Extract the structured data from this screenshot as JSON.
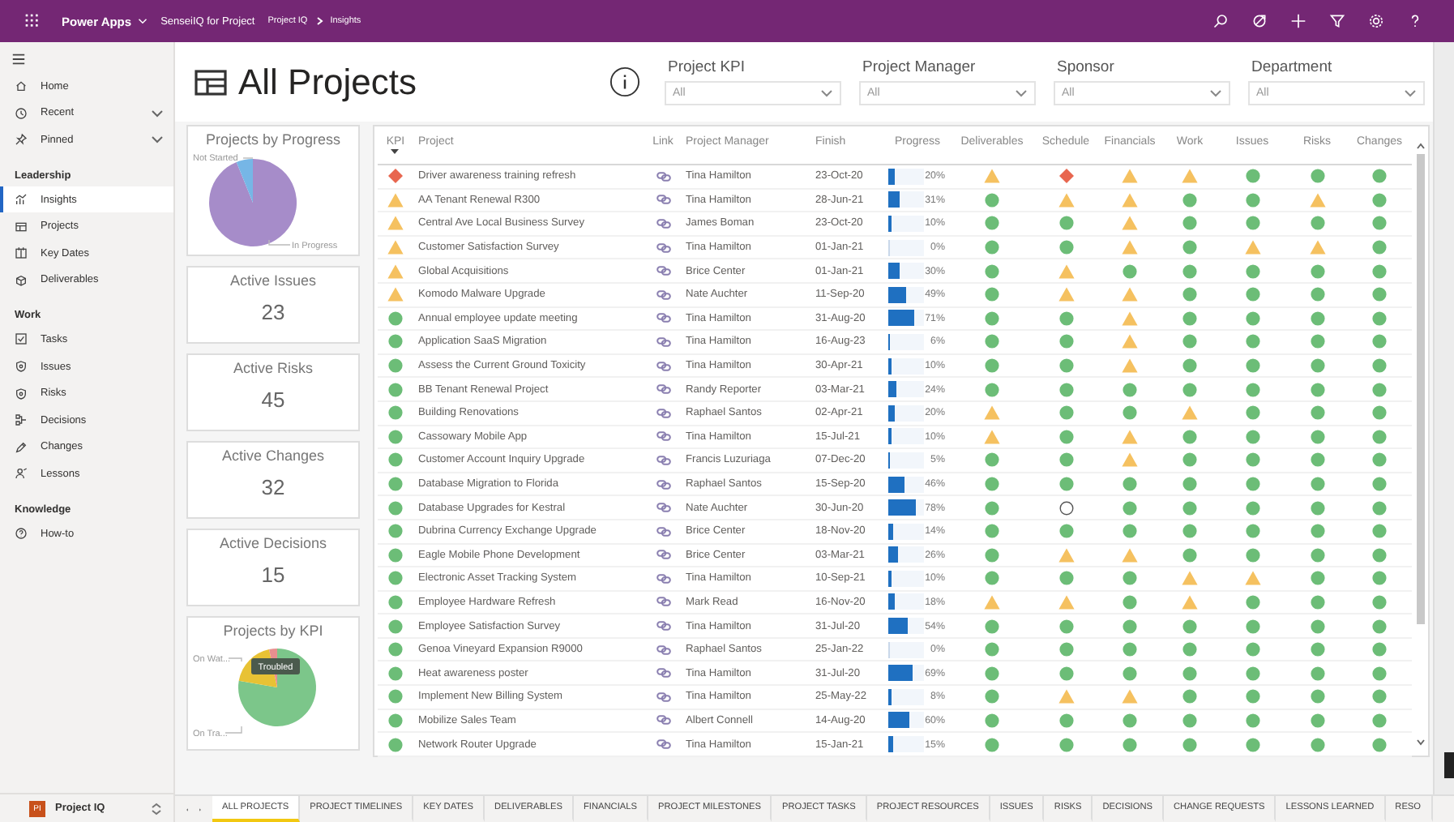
{
  "top_bar": {
    "app_name": "Power Apps",
    "environment": "SenseiIQ for Project",
    "breadcrumb": [
      "Project IQ",
      "Insights"
    ]
  },
  "sidebar": {
    "top_items": [
      {
        "label": "Home",
        "has_menu": false,
        "selected": false
      },
      {
        "label": "Recent",
        "has_menu": true,
        "selected": false
      },
      {
        "label": "Pinned",
        "has_menu": true,
        "selected": false
      }
    ],
    "sections": [
      {
        "title": "Leadership",
        "items": [
          {
            "label": "Insights",
            "selected": true
          },
          {
            "label": "Projects",
            "selected": false
          },
          {
            "label": "Key Dates",
            "selected": false
          },
          {
            "label": "Deliverables",
            "selected": false
          }
        ]
      },
      {
        "title": "Work",
        "items": [
          {
            "label": "Tasks",
            "selected": false
          },
          {
            "label": "Issues",
            "selected": false
          },
          {
            "label": "Risks",
            "selected": false
          },
          {
            "label": "Decisions",
            "selected": false
          },
          {
            "label": "Changes",
            "selected": false
          },
          {
            "label": "Lessons",
            "selected": false
          }
        ]
      },
      {
        "title": "Knowledge",
        "items": [
          {
            "label": "How-to",
            "selected": false
          }
        ]
      }
    ],
    "app_switcher": {
      "badge": "PI",
      "name": "Project IQ"
    }
  },
  "page": {
    "title": "All Projects"
  },
  "filters": [
    {
      "label": "Project KPI",
      "value": "All"
    },
    {
      "label": "Project Manager",
      "value": "All"
    },
    {
      "label": "Sponsor",
      "value": "All"
    },
    {
      "label": "Department",
      "value": "All"
    }
  ],
  "cards": [
    {
      "kind": "progress_pie",
      "title": "Projects by Progress",
      "labels": [
        "Not Started",
        "In Progress"
      ]
    },
    {
      "kind": "metric",
      "title": "Active Issues",
      "value": "23"
    },
    {
      "kind": "metric",
      "title": "Active Risks",
      "value": "45"
    },
    {
      "kind": "metric",
      "title": "Active Changes",
      "value": "32"
    },
    {
      "kind": "metric",
      "title": "Active Decisions",
      "value": "15"
    },
    {
      "kind": "kpi_pie",
      "title": "Projects by KPI",
      "labels": [
        "On Wat...",
        "On Tra..."
      ],
      "tooltip": "Troubled"
    }
  ],
  "table": {
    "columns": [
      {
        "label": "KPI",
        "sorted": true
      },
      {
        "label": "Project",
        "sorted": false
      },
      {
        "label": "Link",
        "sorted": false
      },
      {
        "label": "Project Manager",
        "sorted": false
      },
      {
        "label": "Finish",
        "sorted": false
      },
      {
        "label": "Progress",
        "sorted": false
      },
      {
        "label": "Deliverables",
        "sorted": false
      },
      {
        "label": "Schedule",
        "sorted": false
      },
      {
        "label": "Financials",
        "sorted": false
      },
      {
        "label": "Work",
        "sorted": false
      },
      {
        "label": "Issues",
        "sorted": false
      },
      {
        "label": "Risks",
        "sorted": false
      },
      {
        "label": "Changes",
        "sorted": false
      }
    ],
    "rows": [
      {
        "kpi": {
          "kind": "critical"
        },
        "project": "Driver awareness training refresh",
        "manager": "Tina Hamilton",
        "finish": "23-Oct-20",
        "progress": "20%",
        "level": 0.2,
        "statuses": [
          {
            "kind": "warning"
          },
          {
            "kind": "critical"
          },
          {
            "kind": "warning"
          },
          {
            "kind": "warning"
          },
          {
            "kind": "good"
          },
          {
            "kind": "good"
          },
          {
            "kind": "good"
          }
        ]
      },
      {
        "kpi": {
          "kind": "warning"
        },
        "project": "AA Tenant Renewal R300",
        "manager": "Tina Hamilton",
        "finish": "28-Jun-21",
        "progress": "31%",
        "level": 0.31,
        "statuses": [
          {
            "kind": "good"
          },
          {
            "kind": "warning"
          },
          {
            "kind": "warning"
          },
          {
            "kind": "good"
          },
          {
            "kind": "good"
          },
          {
            "kind": "warning"
          },
          {
            "kind": "good"
          }
        ]
      },
      {
        "kpi": {
          "kind": "warning"
        },
        "project": "Central Ave Local Business Survey",
        "manager": "James Boman",
        "finish": "23-Oct-20",
        "progress": "10%",
        "level": 0.1,
        "statuses": [
          {
            "kind": "good"
          },
          {
            "kind": "good"
          },
          {
            "kind": "warning"
          },
          {
            "kind": "good"
          },
          {
            "kind": "good"
          },
          {
            "kind": "good"
          },
          {
            "kind": "good"
          }
        ]
      },
      {
        "kpi": {
          "kind": "warning"
        },
        "project": "Customer Satisfaction Survey",
        "manager": "Tina Hamilton",
        "finish": "01-Jan-21",
        "progress": "0%",
        "level": 0,
        "statuses": [
          {
            "kind": "good"
          },
          {
            "kind": "good"
          },
          {
            "kind": "warning"
          },
          {
            "kind": "good"
          },
          {
            "kind": "warning"
          },
          {
            "kind": "warning"
          },
          {
            "kind": "good"
          }
        ]
      },
      {
        "kpi": {
          "kind": "warning"
        },
        "project": "Global Acquisitions",
        "manager": "Brice Center",
        "finish": "01-Jan-21",
        "progress": "30%",
        "level": 0.3,
        "statuses": [
          {
            "kind": "good"
          },
          {
            "kind": "warning"
          },
          {
            "kind": "good"
          },
          {
            "kind": "good"
          },
          {
            "kind": "good"
          },
          {
            "kind": "good"
          },
          {
            "kind": "good"
          }
        ]
      },
      {
        "kpi": {
          "kind": "warning"
        },
        "project": "Komodo Malware Upgrade",
        "manager": "Nate Auchter",
        "finish": "11-Sep-20",
        "progress": "49%",
        "level": 0.49,
        "statuses": [
          {
            "kind": "good"
          },
          {
            "kind": "warning"
          },
          {
            "kind": "warning"
          },
          {
            "kind": "good"
          },
          {
            "kind": "good"
          },
          {
            "kind": "good"
          },
          {
            "kind": "good"
          }
        ]
      },
      {
        "kpi": {
          "kind": "good"
        },
        "project": "Annual employee update meeting",
        "manager": "Tina Hamilton",
        "finish": "31-Aug-20",
        "progress": "71%",
        "level": 0.71,
        "statuses": [
          {
            "kind": "good"
          },
          {
            "kind": "good"
          },
          {
            "kind": "warning"
          },
          {
            "kind": "good"
          },
          {
            "kind": "good"
          },
          {
            "kind": "good"
          },
          {
            "kind": "good"
          }
        ]
      },
      {
        "kpi": {
          "kind": "good"
        },
        "project": "Application SaaS Migration",
        "manager": "Tina Hamilton",
        "finish": "16-Aug-23",
        "progress": "6%",
        "level": 0.06,
        "statuses": [
          {
            "kind": "good"
          },
          {
            "kind": "good"
          },
          {
            "kind": "warning"
          },
          {
            "kind": "good"
          },
          {
            "kind": "good"
          },
          {
            "kind": "good"
          },
          {
            "kind": "good"
          }
        ]
      },
      {
        "kpi": {
          "kind": "good"
        },
        "project": "Assess the Current Ground Toxicity",
        "manager": "Tina Hamilton",
        "finish": "30-Apr-21",
        "progress": "10%",
        "level": 0.1,
        "statuses": [
          {
            "kind": "good"
          },
          {
            "kind": "good"
          },
          {
            "kind": "warning"
          },
          {
            "kind": "good"
          },
          {
            "kind": "good"
          },
          {
            "kind": "good"
          },
          {
            "kind": "good"
          }
        ]
      },
      {
        "kpi": {
          "kind": "good"
        },
        "project": "BB Tenant Renewal Project",
        "manager": "Randy Reporter",
        "finish": "03-Mar-21",
        "progress": "24%",
        "level": 0.24,
        "statuses": [
          {
            "kind": "good"
          },
          {
            "kind": "good"
          },
          {
            "kind": "good"
          },
          {
            "kind": "good"
          },
          {
            "kind": "good"
          },
          {
            "kind": "good"
          },
          {
            "kind": "good"
          }
        ]
      },
      {
        "kpi": {
          "kind": "good"
        },
        "project": "Building Renovations",
        "manager": "Raphael Santos",
        "finish": "02-Apr-21",
        "progress": "20%",
        "level": 0.2,
        "statuses": [
          {
            "kind": "warning"
          },
          {
            "kind": "good"
          },
          {
            "kind": "good"
          },
          {
            "kind": "warning"
          },
          {
            "kind": "good"
          },
          {
            "kind": "good"
          },
          {
            "kind": "good"
          }
        ]
      },
      {
        "kpi": {
          "kind": "good"
        },
        "project": "Cassowary Mobile App",
        "manager": "Tina Hamilton",
        "finish": "15-Jul-21",
        "progress": "10%",
        "level": 0.1,
        "statuses": [
          {
            "kind": "warning"
          },
          {
            "kind": "good"
          },
          {
            "kind": "warning"
          },
          {
            "kind": "good"
          },
          {
            "kind": "good"
          },
          {
            "kind": "good"
          },
          {
            "kind": "good"
          }
        ]
      },
      {
        "kpi": {
          "kind": "good"
        },
        "project": "Customer Account Inquiry Upgrade",
        "manager": "Francis Luzuriaga",
        "finish": "07-Dec-20",
        "progress": "5%",
        "level": 0.05,
        "statuses": [
          {
            "kind": "good"
          },
          {
            "kind": "good"
          },
          {
            "kind": "warning"
          },
          {
            "kind": "good"
          },
          {
            "kind": "good"
          },
          {
            "kind": "good"
          },
          {
            "kind": "good"
          }
        ]
      },
      {
        "kpi": {
          "kind": "good"
        },
        "project": "Database Migration to Florida",
        "manager": "Raphael Santos",
        "finish": "15-Sep-20",
        "progress": "46%",
        "level": 0.46,
        "statuses": [
          {
            "kind": "good"
          },
          {
            "kind": "good"
          },
          {
            "kind": "good"
          },
          {
            "kind": "good"
          },
          {
            "kind": "good"
          },
          {
            "kind": "good"
          },
          {
            "kind": "good"
          }
        ]
      },
      {
        "kpi": {
          "kind": "good"
        },
        "project": "Database Upgrades for Kestral",
        "manager": "Nate Auchter",
        "finish": "30-Jun-20",
        "progress": "78%",
        "level": 0.78,
        "statuses": [
          {
            "kind": "good"
          },
          {
            "kind": "none"
          },
          {
            "kind": "good"
          },
          {
            "kind": "good"
          },
          {
            "kind": "good"
          },
          {
            "kind": "good"
          },
          {
            "kind": "good"
          }
        ]
      },
      {
        "kpi": {
          "kind": "good"
        },
        "project": "Dubrina Currency Exchange Upgrade",
        "manager": "Brice Center",
        "finish": "18-Nov-20",
        "progress": "14%",
        "level": 0.14,
        "statuses": [
          {
            "kind": "good"
          },
          {
            "kind": "good"
          },
          {
            "kind": "good"
          },
          {
            "kind": "good"
          },
          {
            "kind": "good"
          },
          {
            "kind": "good"
          },
          {
            "kind": "good"
          }
        ]
      },
      {
        "kpi": {
          "kind": "good"
        },
        "project": "Eagle Mobile Phone Development",
        "manager": "Brice Center",
        "finish": "03-Mar-21",
        "progress": "26%",
        "level": 0.26,
        "statuses": [
          {
            "kind": "good"
          },
          {
            "kind": "warning"
          },
          {
            "kind": "warning"
          },
          {
            "kind": "good"
          },
          {
            "kind": "good"
          },
          {
            "kind": "good"
          },
          {
            "kind": "good"
          }
        ]
      },
      {
        "kpi": {
          "kind": "good"
        },
        "project": "Electronic Asset Tracking System",
        "manager": "Tina Hamilton",
        "finish": "10-Sep-21",
        "progress": "10%",
        "level": 0.1,
        "statuses": [
          {
            "kind": "good"
          },
          {
            "kind": "good"
          },
          {
            "kind": "good"
          },
          {
            "kind": "warning"
          },
          {
            "kind": "warning"
          },
          {
            "kind": "good"
          },
          {
            "kind": "good"
          }
        ]
      },
      {
        "kpi": {
          "kind": "good"
        },
        "project": "Employee Hardware Refresh",
        "manager": "Mark Read",
        "finish": "16-Nov-20",
        "progress": "18%",
        "level": 0.18,
        "statuses": [
          {
            "kind": "warning"
          },
          {
            "kind": "warning"
          },
          {
            "kind": "good"
          },
          {
            "kind": "warning"
          },
          {
            "kind": "good"
          },
          {
            "kind": "good"
          },
          {
            "kind": "good"
          }
        ]
      },
      {
        "kpi": {
          "kind": "good"
        },
        "project": "Employee Satisfaction Survey",
        "manager": "Tina Hamilton",
        "finish": "31-Jul-20",
        "progress": "54%",
        "level": 0.54,
        "statuses": [
          {
            "kind": "good"
          },
          {
            "kind": "good"
          },
          {
            "kind": "good"
          },
          {
            "kind": "good"
          },
          {
            "kind": "good"
          },
          {
            "kind": "good"
          },
          {
            "kind": "good"
          }
        ]
      },
      {
        "kpi": {
          "kind": "good"
        },
        "project": "Genoa Vineyard Expansion R9000",
        "manager": "Raphael Santos",
        "finish": "25-Jan-22",
        "progress": "0%",
        "level": 0,
        "statuses": [
          {
            "kind": "good"
          },
          {
            "kind": "good"
          },
          {
            "kind": "good"
          },
          {
            "kind": "good"
          },
          {
            "kind": "good"
          },
          {
            "kind": "good"
          },
          {
            "kind": "good"
          }
        ]
      },
      {
        "kpi": {
          "kind": "good"
        },
        "project": "Heat awareness poster",
        "manager": "Tina Hamilton",
        "finish": "31-Jul-20",
        "progress": "69%",
        "level": 0.69,
        "statuses": [
          {
            "kind": "good"
          },
          {
            "kind": "good"
          },
          {
            "kind": "good"
          },
          {
            "kind": "good"
          },
          {
            "kind": "good"
          },
          {
            "kind": "good"
          },
          {
            "kind": "good"
          }
        ]
      },
      {
        "kpi": {
          "kind": "good"
        },
        "project": "Implement New Billing System",
        "manager": "Tina Hamilton",
        "finish": "25-May-22",
        "progress": "8%",
        "level": 0.08,
        "statuses": [
          {
            "kind": "good"
          },
          {
            "kind": "warning"
          },
          {
            "kind": "warning"
          },
          {
            "kind": "good"
          },
          {
            "kind": "good"
          },
          {
            "kind": "good"
          },
          {
            "kind": "good"
          }
        ]
      },
      {
        "kpi": {
          "kind": "good"
        },
        "project": "Mobilize Sales Team",
        "manager": "Albert Connell",
        "finish": "14-Aug-20",
        "progress": "60%",
        "level": 0.6,
        "statuses": [
          {
            "kind": "good"
          },
          {
            "kind": "good"
          },
          {
            "kind": "good"
          },
          {
            "kind": "good"
          },
          {
            "kind": "good"
          },
          {
            "kind": "good"
          },
          {
            "kind": "good"
          }
        ]
      },
      {
        "kpi": {
          "kind": "good"
        },
        "project": "Network Router Upgrade",
        "manager": "Tina Hamilton",
        "finish": "15-Jan-21",
        "progress": "15%",
        "level": 0.15,
        "statuses": [
          {
            "kind": "good"
          },
          {
            "kind": "good"
          },
          {
            "kind": "good"
          },
          {
            "kind": "good"
          },
          {
            "kind": "good"
          },
          {
            "kind": "good"
          },
          {
            "kind": "good"
          }
        ]
      }
    ]
  },
  "page_tabs": [
    {
      "label": "ALL PROJECTS",
      "selected": true
    },
    {
      "label": "PROJECT TIMELINES",
      "selected": false
    },
    {
      "label": "KEY DATES",
      "selected": false
    },
    {
      "label": "DELIVERABLES",
      "selected": false
    },
    {
      "label": "FINANCIALS",
      "selected": false
    },
    {
      "label": "PROJECT MILESTONES",
      "selected": false
    },
    {
      "label": "PROJECT TASKS",
      "selected": false
    },
    {
      "label": "PROJECT RESOURCES",
      "selected": false
    },
    {
      "label": "ISSUES",
      "selected": false
    },
    {
      "label": "RISKS",
      "selected": false
    },
    {
      "label": "DECISIONS",
      "selected": false
    },
    {
      "label": "CHANGE REQUESTS",
      "selected": false
    },
    {
      "label": "LESSONS LEARNED",
      "selected": false
    },
    {
      "label": "RESO",
      "selected": false
    }
  ]
}
